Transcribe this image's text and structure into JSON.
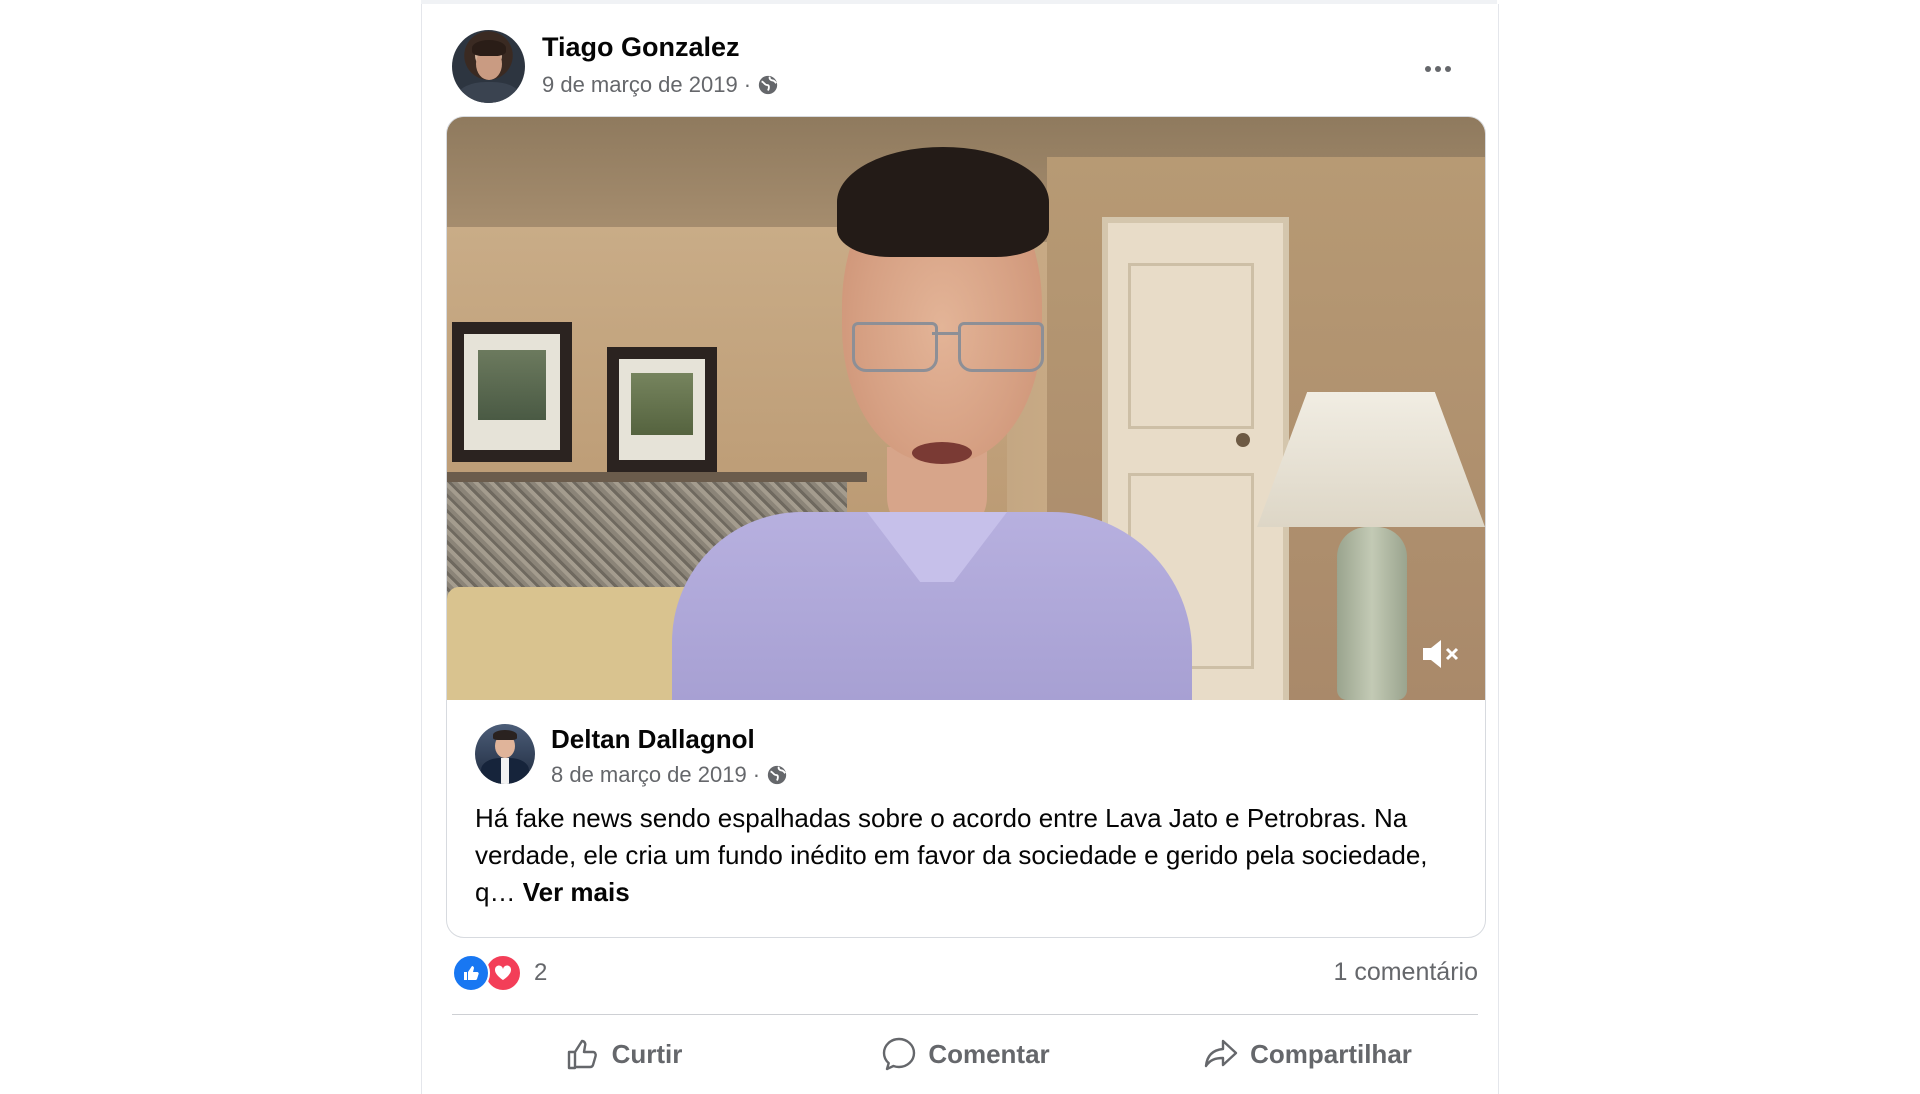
{
  "post": {
    "author": "Tiago Gonzalez",
    "date": "9 de março de 2019 ·",
    "privacy_icon": "globe-icon",
    "more_icon": "more-options-icon"
  },
  "shared_post": {
    "author": "Deltan Dallagnol",
    "date": "8 de março de 2019 ·",
    "privacy_icon": "globe-icon",
    "text": "Há fake news sendo espalhadas sobre o acordo entre Lava Jato e Petrobras. Na verdade, ele cria um fundo inédito em favor da sociedade e gerido pela sociedade, q…",
    "see_more": "Ver mais",
    "video": {
      "muted_icon": "mute-icon"
    }
  },
  "stats": {
    "reaction_count": "2",
    "comments": "1 comentário",
    "reaction_icons": [
      "like-icon",
      "love-icon"
    ],
    "colors": {
      "like": "#1877f2",
      "love": "#f33e58"
    }
  },
  "actions": {
    "like": "Curtir",
    "comment": "Comentar",
    "share": "Compartilhar"
  }
}
